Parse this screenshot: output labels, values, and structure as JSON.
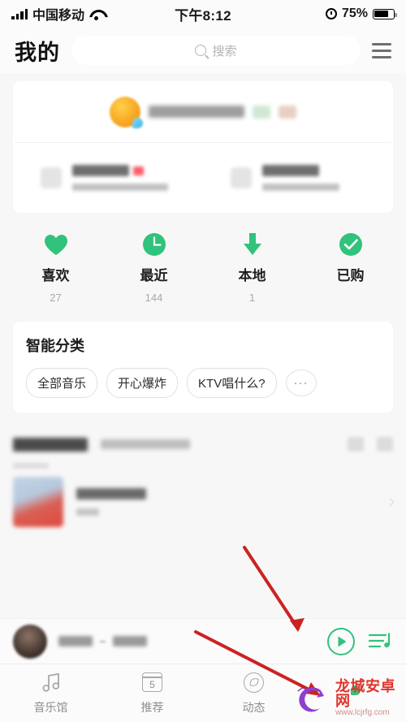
{
  "status_bar": {
    "carrier": "中国移动",
    "time": "下午8:12",
    "battery_percent": "75%",
    "signal_icon": "signal-bars-icon",
    "wifi_icon": "wifi-icon",
    "alarm_icon": "alarm-clock-icon",
    "battery_icon": "battery-icon"
  },
  "header": {
    "title": "我的",
    "search_placeholder": "搜索",
    "search_icon": "search-icon",
    "menu_icon": "hamburger-menu-icon"
  },
  "profile": {
    "username_redacted": "",
    "badges": [
      "",
      ""
    ],
    "entries": [
      {
        "title_redacted": "",
        "subtitle_redacted": "",
        "has_red_dot": true
      },
      {
        "title_redacted": "",
        "subtitle_redacted": "",
        "has_red_dot": false
      }
    ]
  },
  "quick_actions": [
    {
      "label": "喜欢",
      "count": "27",
      "icon": "heart-icon",
      "color": "#31c27c"
    },
    {
      "label": "最近",
      "count": "144",
      "icon": "clock-icon",
      "color": "#31c27c"
    },
    {
      "label": "本地",
      "count": "1",
      "icon": "download-arrow-icon",
      "color": "#31c27c"
    },
    {
      "label": "已购",
      "count": "",
      "icon": "check-circle-icon",
      "color": "#31c27c"
    }
  ],
  "smart_category": {
    "title": "智能分类",
    "chips": [
      "全部音乐",
      "开心爆炸",
      "KTV唱什么?"
    ],
    "more_label": "···"
  },
  "playlist_section": {
    "header_title_redacted": "",
    "header_sub_redacted": "",
    "rows": [
      {
        "title_redacted": "",
        "subtitle_redacted": ""
      }
    ]
  },
  "mini_player": {
    "track_redacted": "",
    "artist_redacted": "",
    "play_icon": "play-button-icon",
    "queue_icon": "playlist-queue-icon",
    "accent": "#31c27c"
  },
  "tab_bar": [
    {
      "label": "音乐馆",
      "icon": "music-note-icon",
      "active": false
    },
    {
      "label": "推荐",
      "icon": "calendar-icon",
      "badge": "5",
      "active": false
    },
    {
      "label": "动态",
      "icon": "compass-icon",
      "active": false
    },
    {
      "label": "",
      "icon": "green-dot-icon",
      "active": true
    }
  ],
  "annotations": {
    "arrow_color": "#cc2222",
    "arrows": [
      {
        "name": "arrow-to-play-button"
      },
      {
        "name": "arrow-to-fourth-tab"
      }
    ]
  },
  "watermark": {
    "site_name": "龙城安卓网",
    "url": "www.lcjrfg.com",
    "logo_icon": "dragon-c-logo-icon"
  }
}
